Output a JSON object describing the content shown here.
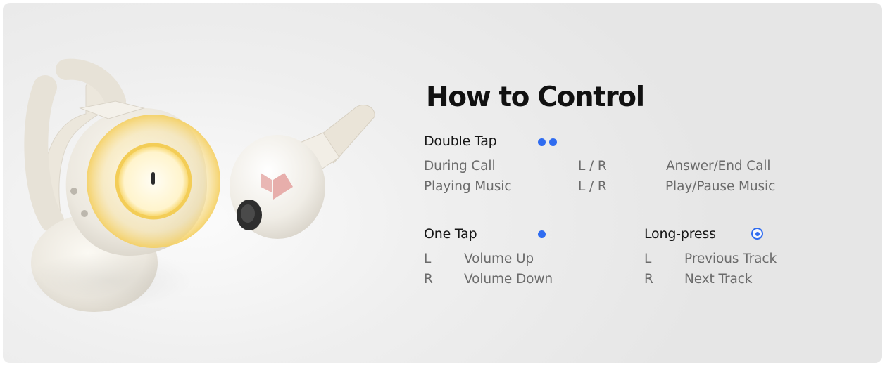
{
  "title": "How to Control",
  "accent_color": "#2f6cf0",
  "double_tap": {
    "heading": "Double Tap",
    "indicator_icon": "double-dot-icon",
    "rows": [
      {
        "action": "During Call",
        "side": "L / R",
        "result": "Answer/End Call"
      },
      {
        "action": "Playing Music",
        "side": "L / R",
        "result": "Play/Pause Music"
      }
    ]
  },
  "one_tap": {
    "heading": "One Tap",
    "indicator_icon": "single-dot-icon",
    "rows": [
      {
        "side": "L",
        "result": "Volume Up"
      },
      {
        "side": "R",
        "result": "Volume Down"
      }
    ]
  },
  "long_press": {
    "heading": "Long-press",
    "indicator_icon": "ring-dot-icon",
    "rows": [
      {
        "side": "L",
        "result": "Previous Track"
      },
      {
        "side": "R",
        "result": "Next Track"
      }
    ]
  }
}
